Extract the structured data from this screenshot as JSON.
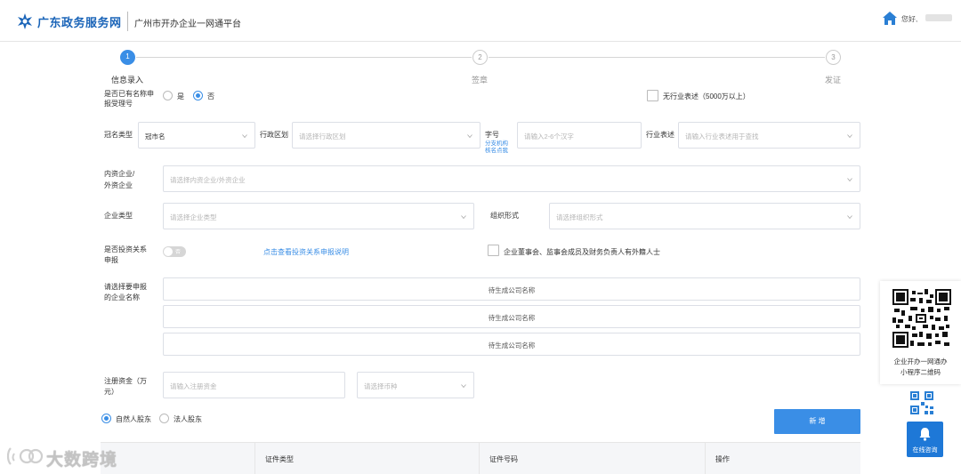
{
  "header": {
    "logo_text": "广东政务服务网",
    "platform_name": "广州市开办企业一网通平台",
    "greeting": "您好,"
  },
  "stepper": {
    "steps": [
      {
        "number": "1",
        "label": "信息录入",
        "active": true
      },
      {
        "number": "2",
        "label": "签章",
        "active": false
      },
      {
        "number": "3",
        "label": "发证",
        "active": false
      }
    ]
  },
  "form": {
    "has_name": {
      "label": "是否已有名称申报受理号",
      "options": [
        {
          "label": "是",
          "selected": false
        },
        {
          "label": "否",
          "selected": true
        }
      ]
    },
    "no_industry": {
      "label": "无行业表述（5000万以上）",
      "checked": false
    },
    "crown_type": {
      "label": "冠名类型",
      "value": "冠市名"
    },
    "district": {
      "label": "行政区划",
      "placeholder": "请选择行政区划"
    },
    "trade_name": {
      "label": "字号",
      "placeholder": "请输入2-6个汉字",
      "link_line1": "分支机构",
      "link_line2": "核名点我"
    },
    "industry": {
      "label": "行业表述",
      "placeholder": "请输入行业表述用于查找"
    },
    "domestic_foreign": {
      "label_line1": "内资企业/",
      "label_line2": "外资企业",
      "placeholder": "请选择内资企业/外资企业"
    },
    "enterprise_type": {
      "label": "企业类型",
      "placeholder": "请选择企业类型"
    },
    "org_form": {
      "label": "组织形式",
      "placeholder": "请选择组织形式"
    },
    "investment_relation": {
      "label_line1": "是否投资关系",
      "label_line2": "申报",
      "toggle_text": "否",
      "link": "点击查看投资关系申报说明"
    },
    "foreign_director": {
      "label": "企业董事会、监事会成员及财务负责人有外籍人士",
      "checked": false
    },
    "company_names": {
      "label_line1": "请选择要申报",
      "label_line2": "的企业名称",
      "slots": [
        "待生成公司名称",
        "待生成公司名称",
        "待生成公司名称"
      ]
    },
    "capital": {
      "label_line1": "注册资金（万",
      "label_line2": "元）",
      "placeholder": "请输入注册资金",
      "currency_placeholder": "请选择币种"
    },
    "shareholder_type": {
      "options": [
        {
          "label": "自然人股东",
          "selected": true
        },
        {
          "label": "法人股东",
          "selected": false
        }
      ]
    },
    "add_button": "新 增"
  },
  "table": {
    "columns": [
      "",
      "证件类型",
      "证件号码",
      "操作"
    ]
  },
  "float_panel": {
    "qr_caption_line1": "企业开办一网通办",
    "qr_caption_line2": "小程序二维码",
    "online_label": "在线咨询"
  },
  "watermark": "大数跨境",
  "colors": {
    "primary": "#3a8ee6",
    "brand": "#1a64b8"
  }
}
